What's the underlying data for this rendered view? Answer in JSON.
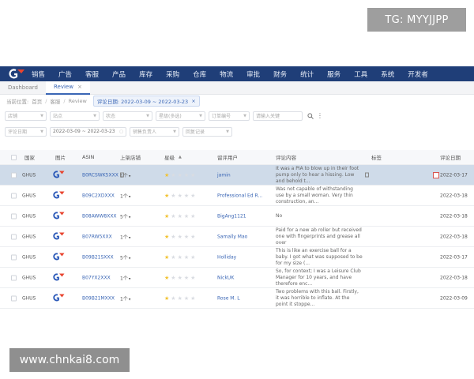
{
  "watermarks": {
    "top": "TG: MYYJJPP",
    "bottom": "www.chnkai8.com"
  },
  "nav": {
    "items": [
      "销售",
      "广告",
      "客服",
      "产品",
      "库存",
      "采购",
      "仓库",
      "物流",
      "审批",
      "财务",
      "统计",
      "服务",
      "工具",
      "系统",
      "开发者"
    ]
  },
  "tabs": [
    {
      "label": "Dashboard",
      "active": false
    },
    {
      "label": "Review",
      "active": true
    }
  ],
  "breadcrumb": {
    "items": [
      "当前位置:",
      "首页",
      "客服",
      "Review"
    ],
    "filter_chip": "评论日期: 2022-03-09 ~ 2022-03-23"
  },
  "filters": {
    "row1": [
      "店铺",
      "站点",
      "状态",
      "星级(多选)",
      "订单编号",
      "请输入关键"
    ],
    "row2": [
      "评论日期",
      "2022-03-09 ~ 2022-03-23",
      "销售负责人",
      "回复记录"
    ]
  },
  "table": {
    "headers": [
      "国家",
      "图片",
      "ASIN",
      "上架店铺",
      "星级",
      "留评用户",
      "评论内容",
      "标签",
      "评论日期"
    ],
    "rows": [
      {
        "country": "GHUS",
        "asin": "B0RCSWK5XXX",
        "listing": "1个",
        "stars": 1,
        "buyer": "jamin",
        "review": "It was a PIA to blow up in their foot pump only to hear a hissing. Low and behold t...",
        "date": "2022-03-17",
        "selected": true
      },
      {
        "country": "GHUS",
        "asin": "B09C2XDXXX",
        "listing": "1个",
        "stars": 1,
        "buyer": "Professional Ed R...",
        "review": "Was not capable of withstanding use by a small woman. Very thin construction, an...",
        "date": "2022-03-18",
        "selected": false
      },
      {
        "country": "GHUS",
        "asin": "B08AWW8XXX",
        "listing": "5个",
        "stars": 1,
        "buyer": "BigAng1121",
        "review": "No",
        "date": "2022-03-18",
        "selected": false
      },
      {
        "country": "GHUS",
        "asin": "B07RW5XXX",
        "listing": "1个",
        "stars": 1,
        "buyer": "Samally Mao",
        "review": "Paid for a new ab roller but received one with fingerprints and grease all over",
        "date": "2022-03-18",
        "selected": false
      },
      {
        "country": "GHUS",
        "asin": "B09B21SXXX",
        "listing": "5个",
        "stars": 1,
        "buyer": "Holliday",
        "review": "This is like an exercise ball for a baby. I got what was supposed to be for my size (...",
        "date": "2022-03-17",
        "selected": false
      },
      {
        "country": "GHUS",
        "asin": "B07YX2XXX",
        "listing": "1个",
        "stars": 1,
        "buyer": "NickUK",
        "review": "So, for context; I was a Leisure Club Manager for 10 years, and have therefore enc...",
        "date": "2022-03-18",
        "selected": false
      },
      {
        "country": "GHUS",
        "asin": "B09B21MXXX",
        "listing": "1个",
        "stars": 1,
        "buyer": "Rose M. L",
        "review": "Two problems with this ball. Firstly, it was horrible to inflate. At the point it stoppe...",
        "date": "2022-03-09",
        "selected": false
      }
    ]
  },
  "colors": {
    "nav_bg": "#1f3e78",
    "accent": "#3a66b5",
    "star": "#f2c230",
    "selected_row": "#cfdbe9"
  }
}
